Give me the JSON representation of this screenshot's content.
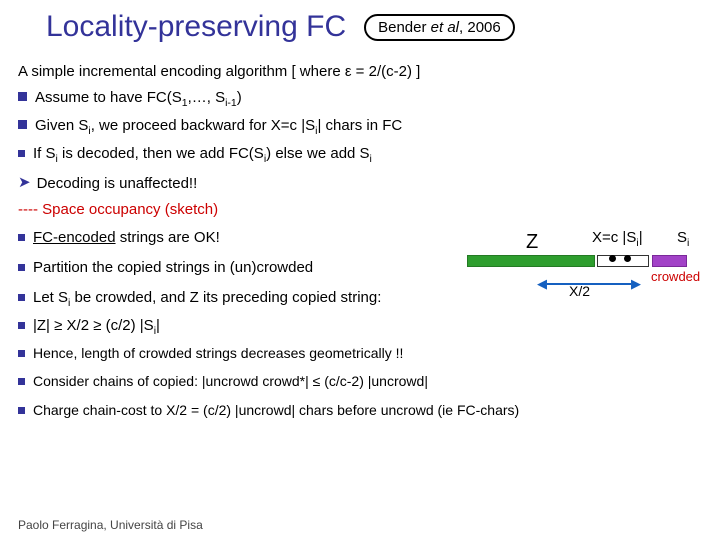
{
  "header": {
    "title": "Locality-preserving FC",
    "cite_prefix": "Bender ",
    "cite_em": "et al",
    "cite_suffix": ", 2006"
  },
  "line_intro": "A simple incremental encoding algorithm  [ where ε = 2/(c-2) ]",
  "b1_prefix": "Assume to have FC(S",
  "b1_sub1": "1",
  "b1_mid": ",…, S",
  "b1_sub2": "i-1",
  "b1_suffix": ")",
  "b2_prefix": "Given S",
  "b2_sub": "i",
  "b2_mid": ", we proceed backward for X=c |S",
  "b2_sub2": "i",
  "b2_suffix": "| chars in FC",
  "b3_prefix": "If S",
  "b3_sub": "i",
  "b3_mid": " is decoded, then we add FC(S",
  "b3_sub2": "i",
  "b3_mid2": ") else we add S",
  "b3_sub3": "i",
  "decode": "Decoding is unaffected!!",
  "sketch": "---- Space occupancy (sketch)",
  "s1a": "FC-encoded",
  "s1b": " strings are OK!",
  "s2": "Partition the copied strings in (un)crowded",
  "s3_prefix": "Let S",
  "s3_sub": "i",
  "s3_suffix": " be crowded, and Z its preceding copied string:",
  "s4_prefix": "|Z| ≥ X/2 ≥ (c/2) |S",
  "s4_sub": "i",
  "s4_suffix": "|",
  "s5": "Hence, length of crowded strings decreases geometrically !!",
  "s6": "Consider chains of copied: |uncrowd crowd*| ≤ (c/c-2) |uncrowd|",
  "s7": "Charge chain-cost to X/2 = (c/2) |uncrowd| chars before uncrowd (ie FC-chars)",
  "footer": "Paolo Ferragina, Università di Pisa",
  "diag": {
    "z": "Z",
    "xlabel_pre": "X=c |S",
    "xlabel_sub": "i",
    "xlabel_suf": "|",
    "si_pre": "S",
    "si_sub": "i",
    "crowded": "crowded",
    "x2": "X/2"
  }
}
